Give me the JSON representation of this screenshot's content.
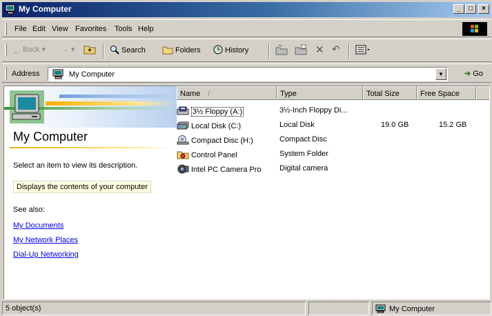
{
  "window": {
    "title": "My Computer",
    "controls": {
      "minimize": "_",
      "maximize": "□",
      "close": "×"
    }
  },
  "menubar": {
    "items": [
      "File",
      "Edit",
      "View",
      "Favorites",
      "Tools",
      "Help"
    ]
  },
  "toolbar": {
    "back_label": "Back",
    "search_label": "Search",
    "folders_label": "Folders",
    "history_label": "History"
  },
  "address": {
    "label": "Address",
    "value": "My Computer",
    "go_label": "Go"
  },
  "webview": {
    "title": "My Computer",
    "description": "Select an item to view its description.",
    "tip": "Displays the contents of your computer",
    "see_also": "See also:",
    "links": [
      "My Documents",
      "My Network Places",
      "Dial-Up Networking"
    ]
  },
  "list": {
    "columns": [
      "Name",
      "Type",
      "Total Size",
      "Free Space"
    ],
    "sort_indicator": "/",
    "rows": [
      {
        "icon": "floppy-drive-icon",
        "name": "3½ Floppy (A:)",
        "type": "3½-Inch Floppy Di...",
        "total": "",
        "free": ""
      },
      {
        "icon": "hard-disk-icon",
        "name": "Local Disk (C:)",
        "type": "Local Disk",
        "total": "19.0 GB",
        "free": "15.2 GB"
      },
      {
        "icon": "cd-drive-icon",
        "name": "Compact Disc (H:)",
        "type": "Compact Disc",
        "total": "",
        "free": ""
      },
      {
        "icon": "control-panel-icon",
        "name": "Control Panel",
        "type": "System Folder",
        "total": "",
        "free": ""
      },
      {
        "icon": "camera-icon",
        "name": "Intel PC Camera Pro",
        "type": "Digital camera",
        "total": "",
        "free": ""
      }
    ]
  },
  "status": {
    "objects": "5 object(s)",
    "zone": "My Computer"
  }
}
